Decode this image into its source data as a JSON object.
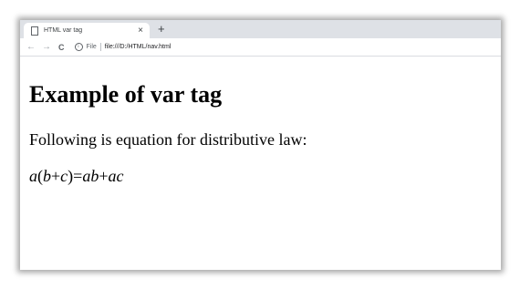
{
  "browser": {
    "tab": {
      "title": "HTML var tag",
      "close_glyph": "×",
      "icon": "page-icon"
    },
    "new_tab_glyph": "+",
    "nav": {
      "back_glyph": "←",
      "forward_glyph": "→",
      "reload_glyph": "C"
    },
    "address": {
      "info_glyph": "i",
      "scheme_label": "File",
      "url": "file:///D:/HTML/nav.html"
    }
  },
  "page": {
    "heading": "Example of var tag",
    "paragraph": "Following is equation for distributive law:",
    "equation": {
      "a": "a",
      "open": "(",
      "b": "b",
      "plus1": "+",
      "c": "c",
      "close_eq": ")=",
      "ab": "ab",
      "plus2": "+",
      "ac": "ac"
    }
  }
}
